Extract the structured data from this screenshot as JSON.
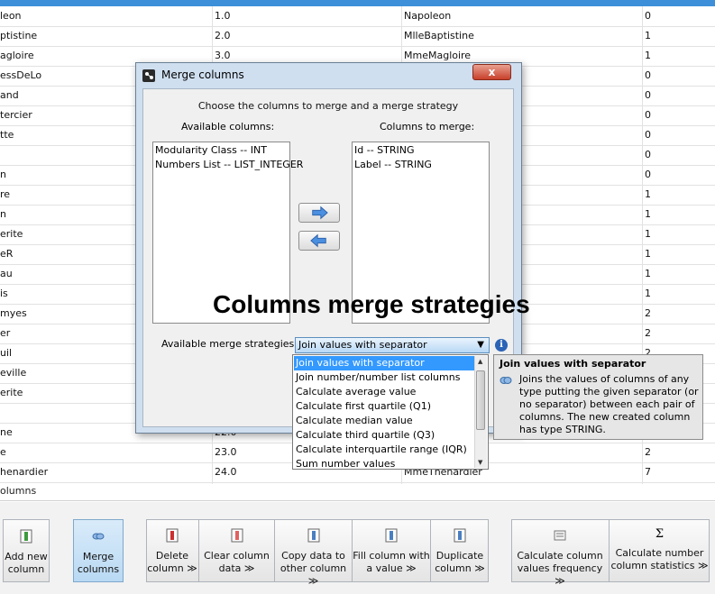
{
  "table": {
    "rows": [
      [
        "leon",
        "1.0",
        "Napoleon",
        "0"
      ],
      [
        "ptistine",
        "2.0",
        "MlleBaptistine",
        "1"
      ],
      [
        "agloire",
        "3.0",
        "MmeMagloire",
        "1"
      ],
      [
        "essDeLo",
        "",
        "",
        "0"
      ],
      [
        "and",
        "",
        "",
        "0"
      ],
      [
        "tercier",
        "",
        "",
        "0"
      ],
      [
        "tte",
        "",
        "",
        "0"
      ],
      [
        "",
        "",
        "",
        "0"
      ],
      [
        "n",
        "",
        "",
        "0"
      ],
      [
        "re",
        "",
        "",
        "1"
      ],
      [
        "n",
        "",
        "",
        "1"
      ],
      [
        "erite",
        "",
        "",
        "1"
      ],
      [
        "eR",
        "",
        "",
        "1"
      ],
      [
        "au",
        "",
        "",
        "1"
      ],
      [
        "is",
        "",
        "",
        "1"
      ],
      [
        "myes",
        "",
        "",
        "2"
      ],
      [
        "er",
        "",
        "",
        "2"
      ],
      [
        "uil",
        "",
        "",
        "2"
      ],
      [
        "eville",
        "",
        "",
        ""
      ],
      [
        "erite",
        "",
        "",
        ""
      ],
      [
        "",
        "",
        "",
        ""
      ],
      [
        "ne",
        "22.0",
        "",
        ""
      ],
      [
        "e",
        "23.0",
        "",
        "2"
      ],
      [
        "henardier",
        "24.0",
        "MmeThenardier",
        "7"
      ]
    ]
  },
  "columns_label": "olumns",
  "toolbar": {
    "add_new": "Add new column",
    "merge": "Merge columns",
    "delete": "Delete column ≫",
    "clear": "Clear column data ≫",
    "copy": "Copy data to other column ≫",
    "fill": "Fill column with a value ≫",
    "duplicate": "Duplicate column ≫",
    "frequency": "Calculate column values frequency ≫",
    "statistics": "Calculate number column statistics ≫",
    "sigma": "Σ"
  },
  "dialog": {
    "title": "Merge columns",
    "close": "x",
    "instruction": "Choose the columns to merge and a merge strategy",
    "available_label": "Available columns:",
    "to_merge_label": "Columns to merge:",
    "available": [
      "Modularity Class -- INT",
      "Numbers List -- LIST_INTEGER"
    ],
    "to_merge": [
      "Id -- STRING",
      "Label -- STRING"
    ],
    "strategies_label": "Available merge strategies:",
    "selected_strategy": "Join values with separator",
    "info": "i"
  },
  "dropdown": {
    "options": [
      "Join values with separator",
      "Join number/number list columns",
      "Calculate average value",
      "Calculate first quartile (Q1)",
      "Calculate median value",
      "Calculate third quartile (Q3)",
      "Calculate interquartile range (IQR)",
      "Sum number values"
    ]
  },
  "tooltip": {
    "title": "Join values with separator",
    "text": "Joins the values of columns of any type putting the given separator (or no separator) between each pair of columns. The new created column has type STRING."
  },
  "overlay_title": "Columns merge strategies",
  "colors": {
    "selection": "#3399ff",
    "topbar": "#3c8fd8",
    "close": "#c8402a"
  }
}
